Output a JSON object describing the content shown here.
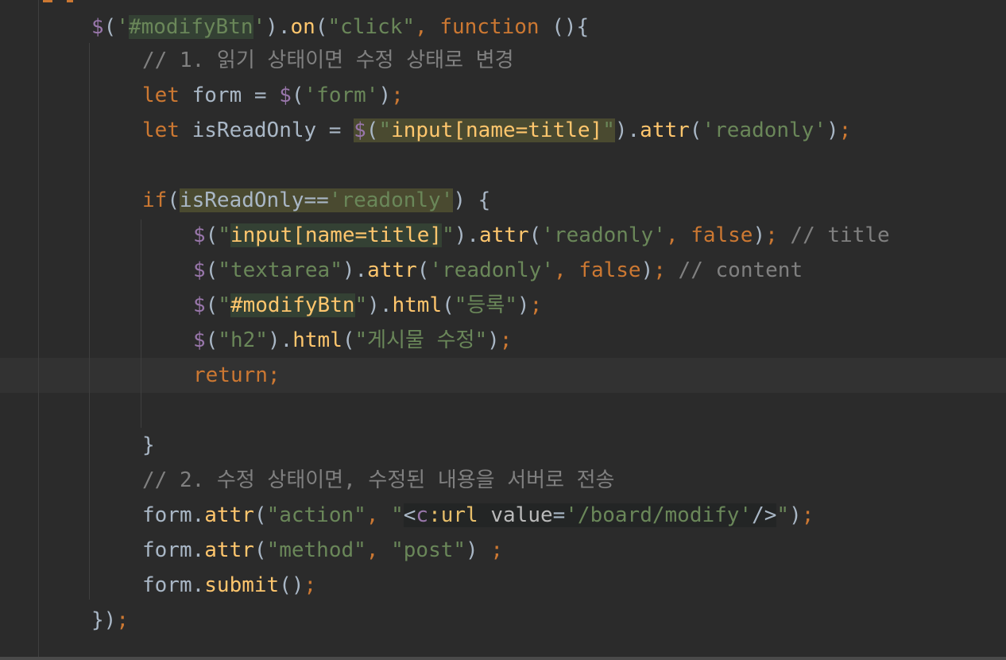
{
  "editor": {
    "colors": {
      "background": "#2b2b2b",
      "text": "#a9b7c6",
      "keyword": "#cc7832",
      "string": "#6a8759",
      "comment": "#808080",
      "function": "#ffc66d",
      "jquery_dollar": "#9876aa"
    },
    "lines": {
      "l1": {
        "dollar": "$",
        "open": "(",
        "q1": "'",
        "selector": "#modifyBtn",
        "q2": "'",
        "close_dot": ").",
        "method": "on",
        "paren": "(",
        "event": "\"click\"",
        "comma": ", ",
        "fn_kw": "function",
        "tail": " (){"
      },
      "l2": {
        "comment": "// 1. 읽기 상태이면 수정 상태로 변경"
      },
      "l3": {
        "kw": "let",
        "rest": " form = ",
        "dollar": "$",
        "open": "(",
        "str": "'form'",
        "close": ")",
        "semi": ";"
      },
      "l4": {
        "kw": "let",
        "rest": " isReadOnly = ",
        "dollar": "$",
        "open": "(",
        "q1": "\"",
        "selector": "input[name=title]",
        "q2": "\"",
        "close_dot": ").",
        "method": "attr",
        "paren": "(",
        "str": "'readonly'",
        "close": ")",
        "semi": ";"
      },
      "l5": {
        "kw": "if",
        "open": "(",
        "var": "isReadOnly==",
        "str": "'readonly'",
        "tail": ") {"
      },
      "l6": {
        "dollar": "$",
        "open": "(",
        "q1": "\"",
        "selector": "input[name=title]",
        "q2": "\"",
        "close_dot": ").",
        "method": "attr",
        "paren": "(",
        "str": "'readonly'",
        "comma": ", ",
        "bool": "false",
        "close": ")",
        "semi": ";",
        "comment": " // title"
      },
      "l7": {
        "dollar": "$",
        "open": "(",
        "str1": "\"textarea\"",
        "close_dot": ").",
        "method": "attr",
        "paren": "(",
        "str": "'readonly'",
        "comma": ", ",
        "bool": "false",
        "close": ")",
        "semi": ";",
        "comment": " // content"
      },
      "l8": {
        "dollar": "$",
        "open": "(",
        "q1": "\"",
        "selector": "#modifyBtn",
        "q2": "\"",
        "close_dot": ").",
        "method": "html",
        "paren": "(",
        "str": "\"등록\"",
        "close": ")",
        "semi": ";"
      },
      "l9": {
        "dollar": "$",
        "open": "(",
        "str1": "\"h2\"",
        "close_dot": ").",
        "method": "html",
        "paren": "(",
        "str": "\"게시물 수정\"",
        "close": ")",
        "semi": ";"
      },
      "l10": {
        "kw": "return",
        "semi": ";"
      },
      "l11": {
        "brace": "}"
      },
      "l12": {
        "comment": "// 2. 수정 상태이면, 수정된 내용을 서버로 전송"
      },
      "l13": {
        "obj": "form.",
        "method": "attr",
        "paren": "(",
        "str1": "\"action\"",
        "comma": ", ",
        "q1": "\"",
        "lt": "<",
        "ns": "c",
        "colon": ":",
        "tag": "url",
        "attr": " value",
        "eq": "=",
        "val": "'/board/modify'",
        "end": "/>",
        "q2": "\"",
        "close": ")",
        "semi": ";"
      },
      "l14": {
        "obj": "form.",
        "method": "attr",
        "paren": "(",
        "str1": "\"method\"",
        "comma": ", ",
        "str2": "\"post\"",
        "close": ") ",
        "semi": ";"
      },
      "l15": {
        "obj": "form.",
        "method": "submit",
        "parens": "()",
        "semi": ";"
      },
      "l16": {
        "close": "})",
        "semi": ";"
      }
    }
  }
}
